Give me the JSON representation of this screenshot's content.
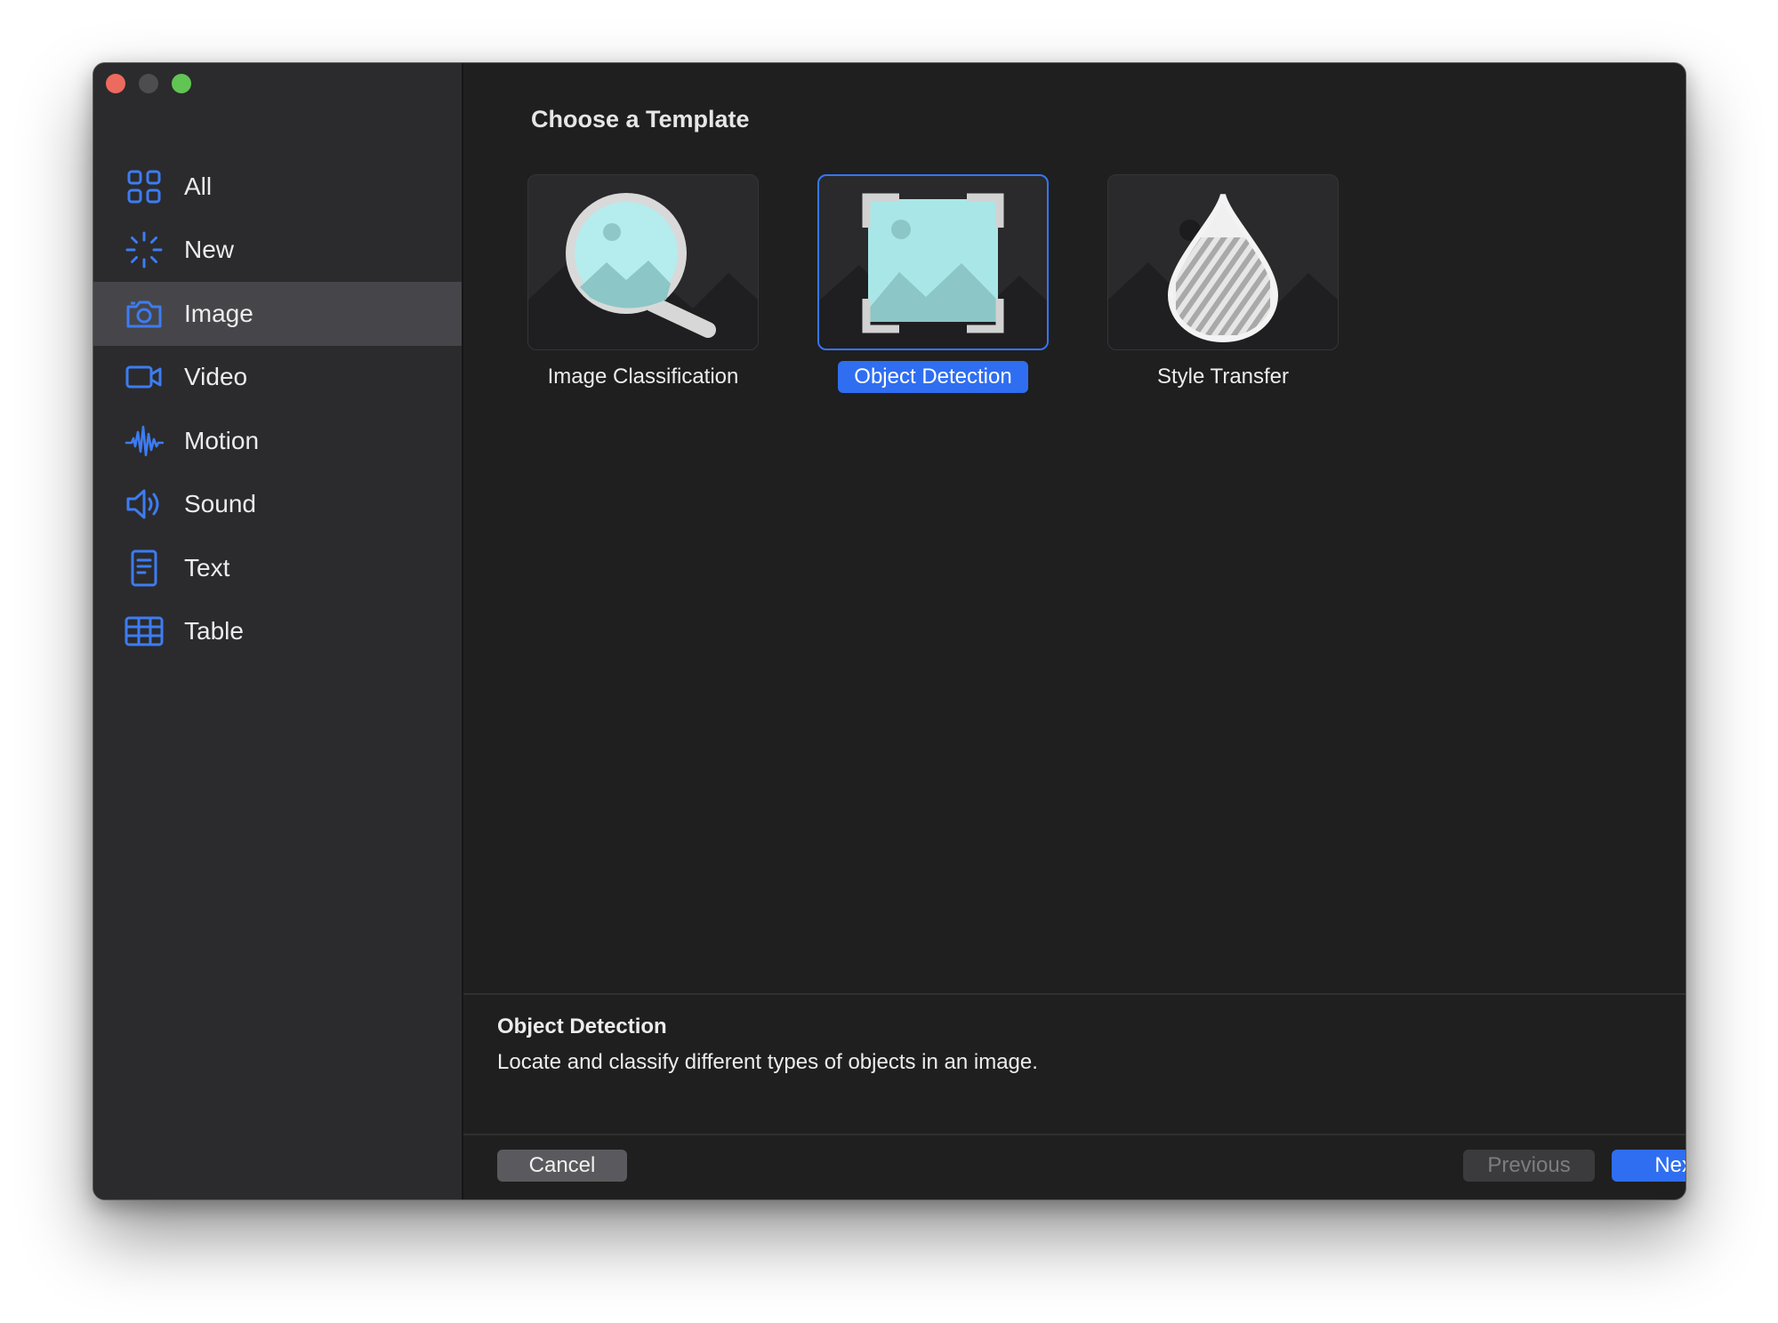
{
  "window": {
    "controls": [
      "close",
      "minimize",
      "zoom"
    ]
  },
  "sidebar": {
    "items": [
      {
        "label": "All",
        "icon": "grid-icon",
        "selected": false
      },
      {
        "label": "New",
        "icon": "sparkle-icon",
        "selected": false
      },
      {
        "label": "Image",
        "icon": "camera-icon",
        "selected": true
      },
      {
        "label": "Video",
        "icon": "video-camera-icon",
        "selected": false
      },
      {
        "label": "Motion",
        "icon": "waveform-icon",
        "selected": false
      },
      {
        "label": "Sound",
        "icon": "speaker-icon",
        "selected": false
      },
      {
        "label": "Text",
        "icon": "document-icon",
        "selected": false
      },
      {
        "label": "Table",
        "icon": "table-icon",
        "selected": false
      }
    ]
  },
  "main": {
    "title": "Choose a Template",
    "templates": [
      {
        "label": "Image Classification",
        "icon": "magnifier-landscape-icon",
        "selected": false
      },
      {
        "label": "Object Detection",
        "icon": "bounding-box-landscape-icon",
        "selected": true
      },
      {
        "label": "Style Transfer",
        "icon": "paint-drop-icon",
        "selected": false
      }
    ]
  },
  "description": {
    "title": "Object Detection",
    "text": "Locate and classify different types of objects in an image."
  },
  "buttons": {
    "cancel": "Cancel",
    "previous": "Previous",
    "next": "Next"
  },
  "colors": {
    "accent": "#2f6ef0",
    "sidebar_bg": "#2b2b2d",
    "content_bg": "#1f1f1f",
    "icon_blue": "#3d7cf2"
  }
}
